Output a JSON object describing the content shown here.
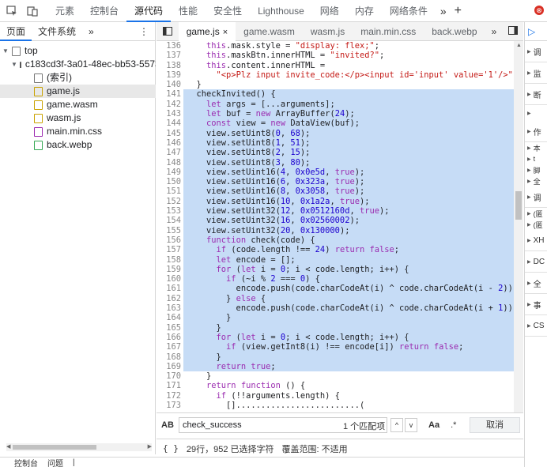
{
  "toolbar": {
    "tabs": [
      "元素",
      "控制台",
      "源代码",
      "性能",
      "安全性",
      "Lighthouse",
      "网络",
      "内存",
      "网络条件"
    ],
    "active_tab": "源代码",
    "more_label": "»",
    "add_label": "+",
    "error_count": "⊗"
  },
  "navigator": {
    "tabs": [
      "页面",
      "文件系统",
      "»"
    ],
    "more_label": "⋮",
    "tree": [
      {
        "label": "top",
        "level": 0
      },
      {
        "label": "c183cd3f-3a01-48ec-bb53-5573",
        "level": 1
      },
      {
        "label": "(索引)",
        "level": 2
      },
      {
        "label": "game.js",
        "level": 2,
        "selected": true
      },
      {
        "label": "game.wasm",
        "level": 2
      },
      {
        "label": "wasm.js",
        "level": 2
      },
      {
        "label": "main.min.css",
        "level": 2
      },
      {
        "label": "back.webp",
        "level": 2
      }
    ]
  },
  "editor": {
    "tabs": [
      "game.js",
      "game.wasm",
      "wasm.js",
      "main.min.css",
      "back.webp"
    ],
    "active_tab": "game.js",
    "close_glyph": "×",
    "more_label": "»",
    "lines": [
      {
        "n": "136",
        "t": "    this.mask.style = \"display: flex;\";",
        "hl": false
      },
      {
        "n": "137",
        "t": "    this.maskBtn.innerHTML = \"invited?\";",
        "hl": false
      },
      {
        "n": "138",
        "t": "    this.content.innerHTML =",
        "hl": false
      },
      {
        "n": "139",
        "t": "      \"<p>Plz input invite_code:</p><input id='input' value='1'/>\";",
        "hl": false
      },
      {
        "n": "140",
        "t": "  }",
        "hl": false
      },
      {
        "n": "141",
        "t": "  checkInvited() {",
        "hl": true
      },
      {
        "n": "142",
        "t": "    let args = [...arguments];",
        "hl": true
      },
      {
        "n": "143",
        "t": "    let buf = new ArrayBuffer(24);",
        "hl": true
      },
      {
        "n": "144",
        "t": "    const view = new DataView(buf);",
        "hl": true
      },
      {
        "n": "145",
        "t": "    view.setUint8(0, 68);",
        "hl": true
      },
      {
        "n": "146",
        "t": "    view.setUint8(1, 51);",
        "hl": true
      },
      {
        "n": "147",
        "t": "    view.setUint8(2, 15);",
        "hl": true
      },
      {
        "n": "148",
        "t": "    view.setUint8(3, 80);",
        "hl": true
      },
      {
        "n": "149",
        "t": "    view.setUint16(4, 0x0e5d, true);",
        "hl": true
      },
      {
        "n": "150",
        "t": "    view.setUint16(6, 0x323a, true);",
        "hl": true
      },
      {
        "n": "151",
        "t": "    view.setUint16(8, 0x3058, true);",
        "hl": true
      },
      {
        "n": "152",
        "t": "    view.setUint16(10, 0x1a2a, true);",
        "hl": true
      },
      {
        "n": "153",
        "t": "    view.setUint32(12, 0x0512160d, true);",
        "hl": true
      },
      {
        "n": "154",
        "t": "    view.setUint32(16, 0x02560002);",
        "hl": true
      },
      {
        "n": "155",
        "t": "    view.setUint32(20, 0x130000);",
        "hl": true
      },
      {
        "n": "156",
        "t": "    function check(code) {",
        "hl": true
      },
      {
        "n": "157",
        "t": "      if (code.length !== 24) return false;",
        "hl": true
      },
      {
        "n": "158",
        "t": "      let encode = [];",
        "hl": true
      },
      {
        "n": "159",
        "t": "      for (let i = 0; i < code.length; i++) {",
        "hl": true
      },
      {
        "n": "160",
        "t": "        if (~i % 2 === 0) {",
        "hl": true
      },
      {
        "n": "161",
        "t": "          encode.push(code.charCodeAt(i) ^ code.charCodeAt(i - 2));",
        "hl": true
      },
      {
        "n": "162",
        "t": "        } else {",
        "hl": true
      },
      {
        "n": "163",
        "t": "          encode.push(code.charCodeAt(i) ^ code.charCodeAt(i + 1));",
        "hl": true
      },
      {
        "n": "164",
        "t": "        }",
        "hl": true
      },
      {
        "n": "165",
        "t": "      }",
        "hl": true
      },
      {
        "n": "166",
        "t": "      for (let i = 0; i < code.length; i++) {",
        "hl": true
      },
      {
        "n": "167",
        "t": "        if (view.getInt8(i) !== encode[i]) return false;",
        "hl": true
      },
      {
        "n": "168",
        "t": "      }",
        "hl": true
      },
      {
        "n": "169",
        "t": "      return true;",
        "hl": true
      },
      {
        "n": "170",
        "t": "    }",
        "hl": false
      },
      {
        "n": "171",
        "t": "    return function () {",
        "hl": false
      },
      {
        "n": "172",
        "t": "      if (!!arguments.length) {",
        "hl": false
      },
      {
        "n": "173",
        "t": "        [].........................(",
        "hl": false
      }
    ]
  },
  "search": {
    "value": "check_success",
    "result_count": "1 个匹配项",
    "up_label": "^",
    "down_label": "v",
    "case_label": "Aa",
    "regex_label": ".*",
    "cancel_label": "取消",
    "ab_label": "AB"
  },
  "status": {
    "braces": "{ }",
    "selection": "29行，952 已选择字符",
    "coverage": "覆盖范围: 不适用"
  },
  "debugger": {
    "rows": [
      "调",
      "监",
      "断",
      "",
      "作",
      "本",
      "t",
      "脚",
      "全",
      "调",
      "(匿",
      "(匿",
      "XH",
      "DC",
      "全",
      "事",
      "CS"
    ]
  },
  "drawer": {
    "tabs": [
      "控制台",
      "问题",
      "|"
    ]
  }
}
